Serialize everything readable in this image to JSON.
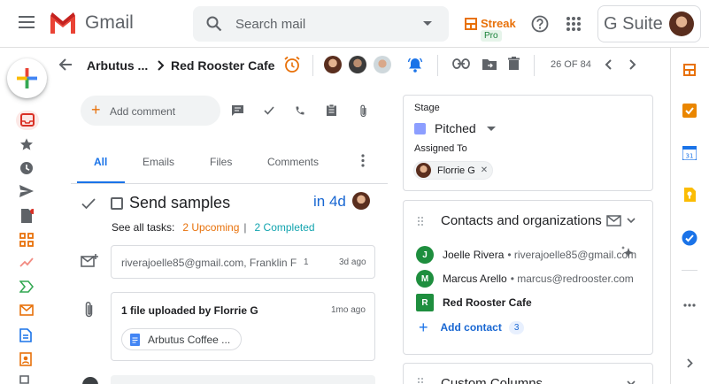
{
  "header": {
    "app_name": "Gmail",
    "search_placeholder": "Search mail",
    "streak_label": "Streak",
    "streak_badge": "Pro",
    "gsuite_label": "G Suite"
  },
  "toolbar": {
    "breadcrumb_box": "Arbutus ...",
    "breadcrumb_org": "Red Rooster Cafe",
    "pagination": "26 OF 84"
  },
  "timeline": {
    "add_comment": "Add comment",
    "tabs": [
      "All",
      "Emails",
      "Files",
      "Comments"
    ],
    "task": {
      "title": "Send samples",
      "due": "in 4d",
      "see_all": "See all tasks:",
      "upcoming": "2 Upcoming",
      "separator": "|",
      "completed": "2 Completed"
    },
    "email_item": {
      "participants": "riverajoelle85@gmail.com, Franklin F",
      "count": "1",
      "time": "3d ago"
    },
    "file_item": {
      "title": "1 file uploaded by Florrie G",
      "time": "1mo ago",
      "file_name": "Arbutus Coffee ..."
    }
  },
  "details": {
    "stage_label": "Stage",
    "stage_value": "Pitched",
    "stage_color": "#8c9eff",
    "assigned_label": "Assigned To",
    "assignee": "Florrie G",
    "contacts_title": "Contacts and organizations",
    "contacts": [
      {
        "initial": "J",
        "name": "Joelle Rivera",
        "email": "• riverajoelle85@gmail.com"
      },
      {
        "initial": "M",
        "name": "Marcus Arello",
        "email": "• marcus@redrooster.com"
      }
    ],
    "organization": {
      "initial": "R",
      "name": "Red Rooster Cafe"
    },
    "add_contact": "Add contact",
    "add_contact_count": "3",
    "custom_columns_title": "Custom Columns"
  },
  "colors": {
    "gmail_red": "#ea4335",
    "streak_orange": "#e8710a",
    "accent_blue": "#1a73e8",
    "contact_green": "#1e8e3e"
  }
}
